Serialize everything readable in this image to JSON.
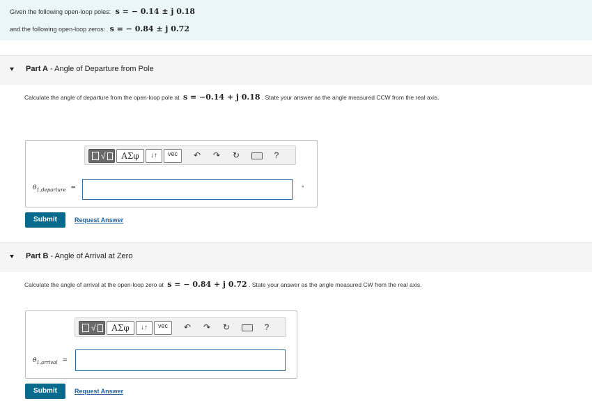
{
  "given": {
    "poles_label": "Given the following open-loop poles:",
    "poles_expr": "s = − 0.14 ± j 0.18",
    "zeros_label": "and the following open-loop zeros:",
    "zeros_expr": "s = − 0.84 ± j 0.72"
  },
  "partA": {
    "prefix": "Part A",
    "title": " - Angle of Departure from Pole",
    "question_pre": "Calculate the angle of departure from the open-loop pole at",
    "question_expr": "s = −0.14 + j 0.18",
    "question_post": ". State your answer as the angle measured CCW from the real axis.",
    "input_label_main": "θ",
    "input_label_sub": "1,departure",
    "equals": "=",
    "unit": "°",
    "submit_label": "Submit",
    "request_label": "Request Answer"
  },
  "partB": {
    "prefix": "Part B",
    "title": " - Angle of Arrival at Zero",
    "question_pre": "Calculate the angle of arrival at the open-loop zero at",
    "question_expr": "s = − 0.84 + j 0.72",
    "question_post": ". State your answer as the angle measured CW from the real axis.",
    "input_label_main": "θ",
    "input_label_sub": "1,arrival",
    "equals": "=",
    "submit_label": "Submit",
    "request_label": "Request Answer"
  },
  "toolbar": {
    "greek": "ΑΣφ",
    "arrows": "↓↑",
    "vec": "vec",
    "help": "?"
  }
}
